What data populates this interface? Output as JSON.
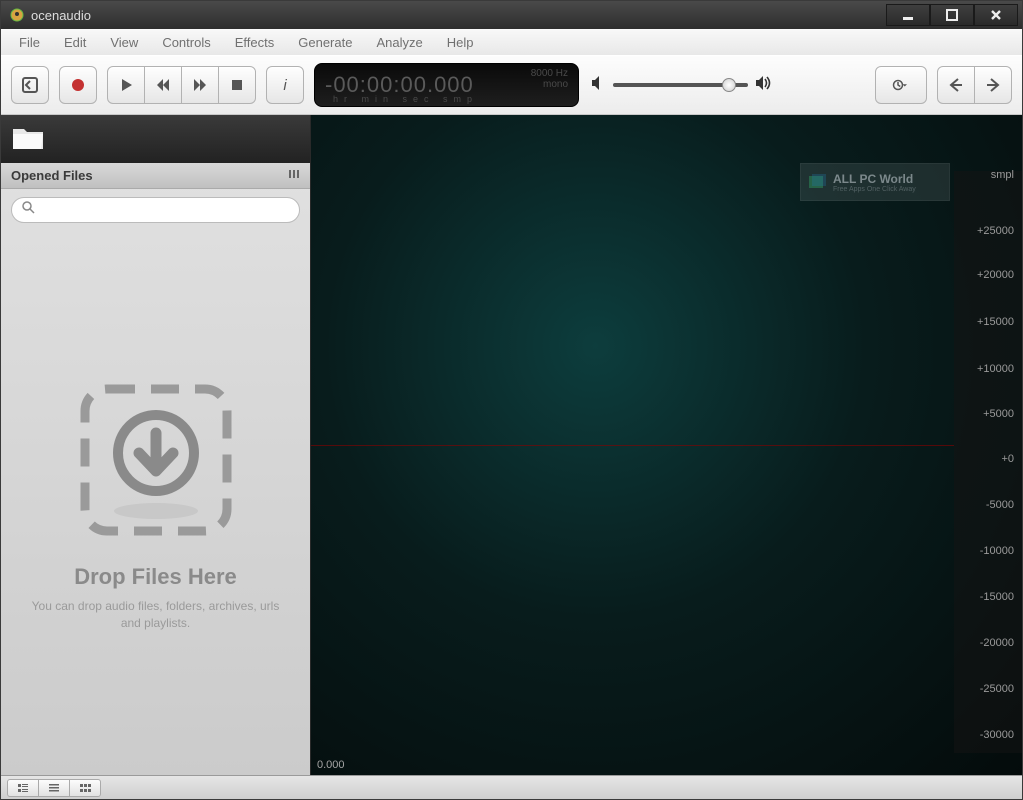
{
  "window": {
    "title": "ocenaudio"
  },
  "menu": {
    "items": [
      "File",
      "Edit",
      "View",
      "Controls",
      "Effects",
      "Generate",
      "Analyze",
      "Help"
    ]
  },
  "toolbar": {
    "time_display": "-00:00:00.000",
    "time_units": "hr  min  sec   smp",
    "sample_rate": "8000 Hz",
    "channels": "mono"
  },
  "sidebar": {
    "header": "Opened Files",
    "search_placeholder": "",
    "drop_title": "Drop Files Here",
    "drop_sub": "You can drop audio files, folders, archives, urls and playlists."
  },
  "waveform": {
    "y_unit_label": "smpl",
    "y_ticks": [
      "+25000",
      "+20000",
      "+15000",
      "+10000",
      "+5000",
      "+0",
      "-5000",
      "-10000",
      "-15000",
      "-20000",
      "-25000",
      "-30000"
    ],
    "time_origin": "0.000",
    "watermark": {
      "title": "ALL PC World",
      "sub": "Free Apps One Click Away"
    }
  }
}
